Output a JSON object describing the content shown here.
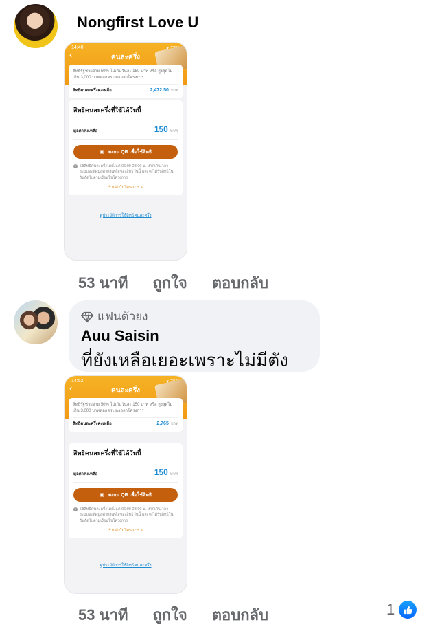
{
  "comments": [
    {
      "author": "Nongfirst Love U",
      "time": "53 นาที",
      "like_label": "ถูกใจ",
      "reply_label": "ตอบกลับ",
      "image": {
        "status_time": "14:40",
        "status_right": "▾ 77%",
        "title": "คนละครึ่ง",
        "info": "สิทธิรัฐช่วยจ่าย 50% ไม่เกินวันละ 150 บาท หรือ สูงสุดไม่เกิน 3,000 บาทตลอดระยะเวลาโครงการ",
        "remaining_label": "สิทธิคนละครึ่งคงเหลือ",
        "remaining_value": "2,472.50",
        "unit": "บาท",
        "today_heading": "สิทธิคนละครึ่งที่ใช้ได้วันนี้",
        "today_label": "มูลค่าคงเหลือ",
        "today_value": "150",
        "scan_button": "สแกน QR เพื่อใช้สิทธิ",
        "note": "ใช้สิทธิคนละครึ่งได้ตั้งแต่ 06:00-23:00 น. หากเกินเวลา ระบบจะตัดมูลค่าคงเหลือของสิทธิวันนี้ และจะได้รับสิทธิในวันถัดไปตามเงื่อนไขโครงการ",
        "shop_link": "ร้านค้าในโครงการ >",
        "history_link": "ดูประวัติการใช้สิทธิคนละครึ่ง"
      }
    },
    {
      "badge": "แฟนตัวยง",
      "author": "Auu Saisin",
      "text": "ที่ยังเหลือเยอะเพราะไม่มีตังเติม",
      "time": "53 นาที",
      "like_label": "ถูกใจ",
      "reply_label": "ตอบกลับ",
      "like_count": "1",
      "image": {
        "status_time": "14:52",
        "status_right": "▾ 76%",
        "title": "คนละครึ่ง",
        "info": "สิทธิรัฐช่วยจ่าย 50% ไม่เกินวันละ 150 บาท หรือ สูงสุดไม่เกิน 3,000 บาทตลอดระยะเวลาโครงการ",
        "remaining_label": "สิทธิคนละครึ่งคงเหลือ",
        "remaining_value": "2,765",
        "unit": "บาท",
        "today_heading": "สิทธิคนละครึ่งที่ใช้ได้วันนี้",
        "today_label": "มูลค่าคงเหลือ",
        "today_value": "150",
        "scan_button": "สแกน QR เพื่อใช้สิทธิ",
        "note": "ใช้สิทธิคนละครึ่งได้ตั้งแต่ 06:00-23:00 น. หากเกินเวลา ระบบจะตัดมูลค่าคงเหลือของสิทธิวันนี้ และจะได้รับสิทธิในวันถัดไปตามเงื่อนไขโครงการ",
        "shop_link": "ร้านค้าในโครงการ >",
        "history_link": "ดูประวัติการใช้สิทธิคนละครึ่ง"
      }
    }
  ],
  "colors": {
    "like_blue": "#0866ff",
    "app_orange": "#f29a18",
    "button_brown": "#c45f0e"
  },
  "icons": [
    "diamond-badge-icon",
    "like-thumb-icon",
    "back-chevron-icon",
    "qr-scan-icon"
  ]
}
